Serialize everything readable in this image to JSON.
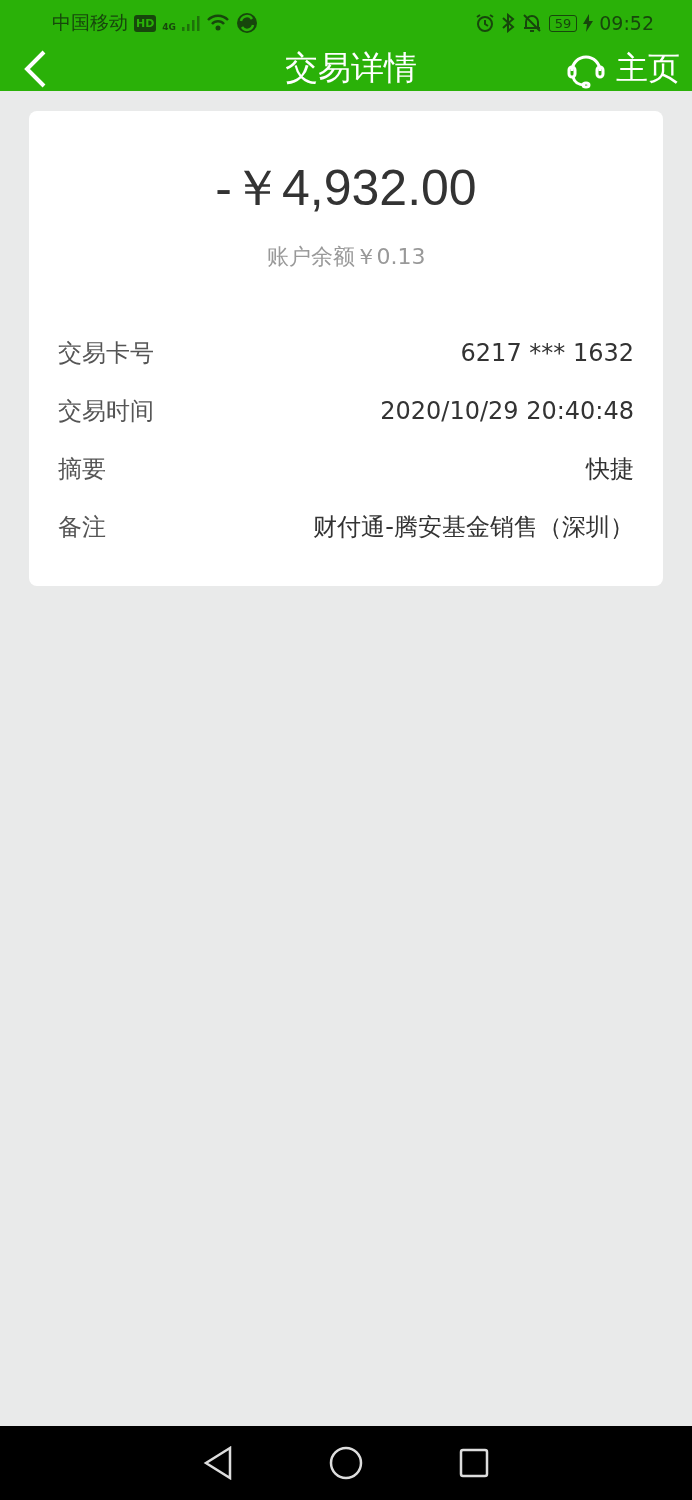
{
  "status_bar": {
    "carrier": "中国移动",
    "hd": "HD",
    "network": "4G",
    "battery": "59",
    "time": "09:52"
  },
  "header": {
    "title": "交易详情",
    "home": "主页"
  },
  "summary": {
    "amount": "-￥4,932.00",
    "balance": "账户余额￥0.13"
  },
  "details": [
    {
      "label": "交易卡号",
      "value": "6217 *** 1632"
    },
    {
      "label": "交易时间",
      "value": "2020/10/29 20:40:48"
    },
    {
      "label": "摘要",
      "value": "快捷"
    },
    {
      "label": "备注",
      "value": "财付通-腾安基金销售（深圳）"
    }
  ]
}
